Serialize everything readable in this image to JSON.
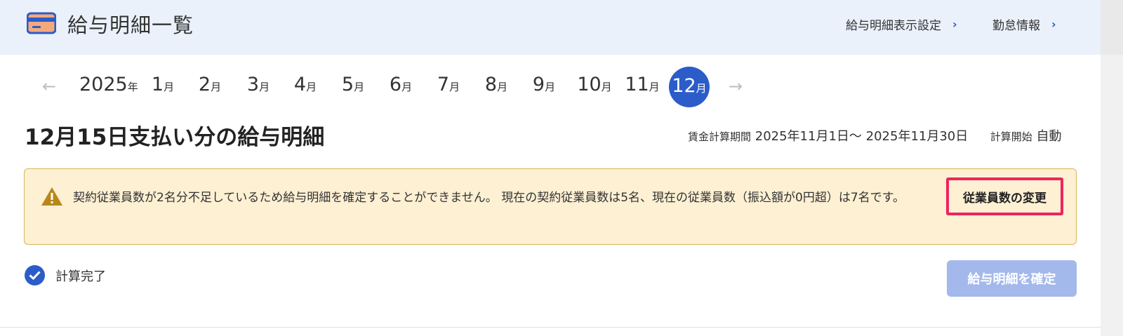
{
  "header": {
    "title": "給与明細一覧",
    "links": [
      {
        "label": "給与明細表示設定",
        "icon": "chevron-right-icon"
      },
      {
        "label": "勤怠情報",
        "icon": "chevron-right-icon"
      }
    ]
  },
  "month_nav": {
    "year": "2025",
    "year_suffix": "年",
    "month_suffix": "月",
    "months": [
      "1",
      "2",
      "3",
      "4",
      "5",
      "6",
      "7",
      "8",
      "9",
      "10",
      "11",
      "12"
    ],
    "selected_month": "12",
    "prev_arrow": "←",
    "next_arrow": "→"
  },
  "payslip": {
    "title": "12月15日支払い分の給与明細",
    "period_label": "賃金計算期間",
    "period_value": "2025年11月1日〜 2025年11月30日",
    "calc_start_label": "計算開始",
    "calc_start_value": "自動"
  },
  "alert": {
    "message": "契約従業員数が2名分不足しているため給与明細を確定することができません。 現在の契約従業員数は5名、現在の従業員数（振込額が0円超）は7名です。",
    "button_label": "従業員数の変更",
    "accent_color": "#f0245e"
  },
  "status": {
    "label": "計算完了"
  },
  "confirm_button": {
    "label": "給与明細を確定",
    "state": "disabled"
  },
  "colors": {
    "primary": "#2b5cc9",
    "header_bg": "#eaf1fb",
    "alert_bg": "#fdf0d3",
    "alert_border": "#d8b65c",
    "confirm_disabled": "#a3b9eb"
  }
}
